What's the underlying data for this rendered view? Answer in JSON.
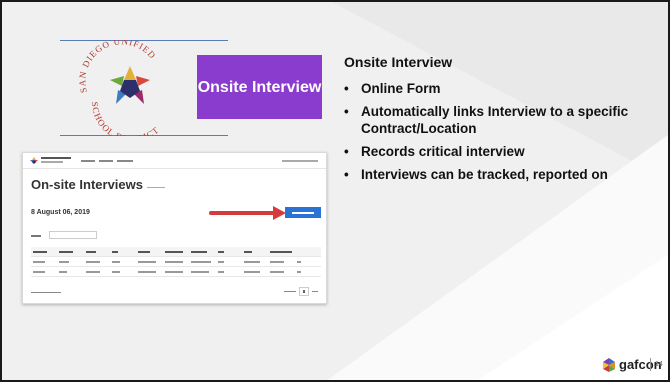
{
  "badge": {
    "text": "Onsite Interview"
  },
  "content": {
    "heading": "Onsite Interview",
    "bullets": [
      "Online Form",
      "Automatically links Interview to a specific Contract/Location",
      "Records critical interview",
      "Interviews can be tracked, reported on"
    ]
  },
  "app": {
    "title": "On-site Interviews",
    "date": "8 August 06, 2019",
    "add_button": "Create New Interview"
  },
  "footer": {
    "brand": "gafcon",
    "page": "14"
  },
  "colors": {
    "badge": "#8a3ccf",
    "accent_red": "#d63a3a",
    "app_button": "#2a72d6"
  }
}
